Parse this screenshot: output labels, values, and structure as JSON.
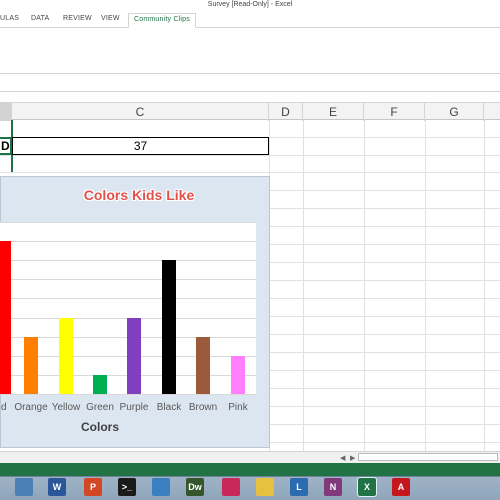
{
  "window": {
    "title": "Survey  [Read-Only] - Excel"
  },
  "ribbon": {
    "tabs": [
      {
        "label": "ULAS"
      },
      {
        "label": "DATA"
      },
      {
        "label": "REVIEW"
      },
      {
        "label": "VIEW"
      },
      {
        "label": "Community Clips",
        "active": true
      }
    ]
  },
  "columns": [
    "C",
    "D",
    "E",
    "F",
    "G"
  ],
  "cells": {
    "d_fragment": "D",
    "c_value": "37"
  },
  "chart_data": {
    "type": "bar",
    "title": "Colors Kids Like",
    "xlabel": "Colors",
    "ylabel": "",
    "categories": [
      "d",
      "Orange",
      "Yellow",
      "Green",
      "Purple",
      "Black",
      "Brown",
      "Pink"
    ],
    "values": [
      8,
      3,
      4,
      1,
      4,
      7,
      3,
      2
    ],
    "ylim": [
      0,
      9
    ],
    "colors": [
      "#ff0000",
      "#ff8000",
      "#ffff00",
      "#00b050",
      "#7f3fbf",
      "#000000",
      "#9c5a3c",
      "#ff7fff"
    ],
    "grid": true
  },
  "taskbar": {
    "icons": [
      {
        "name": "start-icon",
        "color": "#4a7fb5"
      },
      {
        "name": "word-icon",
        "letter": "W",
        "color": "#2b579a"
      },
      {
        "name": "powerpoint-icon",
        "letter": "P",
        "color": "#d24726"
      },
      {
        "name": "cmd-icon",
        "letter": ">_",
        "color": "#1a1a1a"
      },
      {
        "name": "app-icon",
        "color": "#3a7fc0"
      },
      {
        "name": "dreamweaver-icon",
        "letter": "Dw",
        "color": "#35562a"
      },
      {
        "name": "media-icon",
        "color": "#c8285a"
      },
      {
        "name": "folder-icon",
        "color": "#e8c040"
      },
      {
        "name": "lync-icon",
        "letter": "L",
        "color": "#2b6cb0"
      },
      {
        "name": "onenote-icon",
        "letter": "N",
        "color": "#80397b"
      },
      {
        "name": "excel-icon",
        "letter": "X",
        "color": "#217346",
        "active": true
      },
      {
        "name": "acrobat-icon",
        "letter": "A",
        "color": "#c4161c"
      }
    ]
  }
}
